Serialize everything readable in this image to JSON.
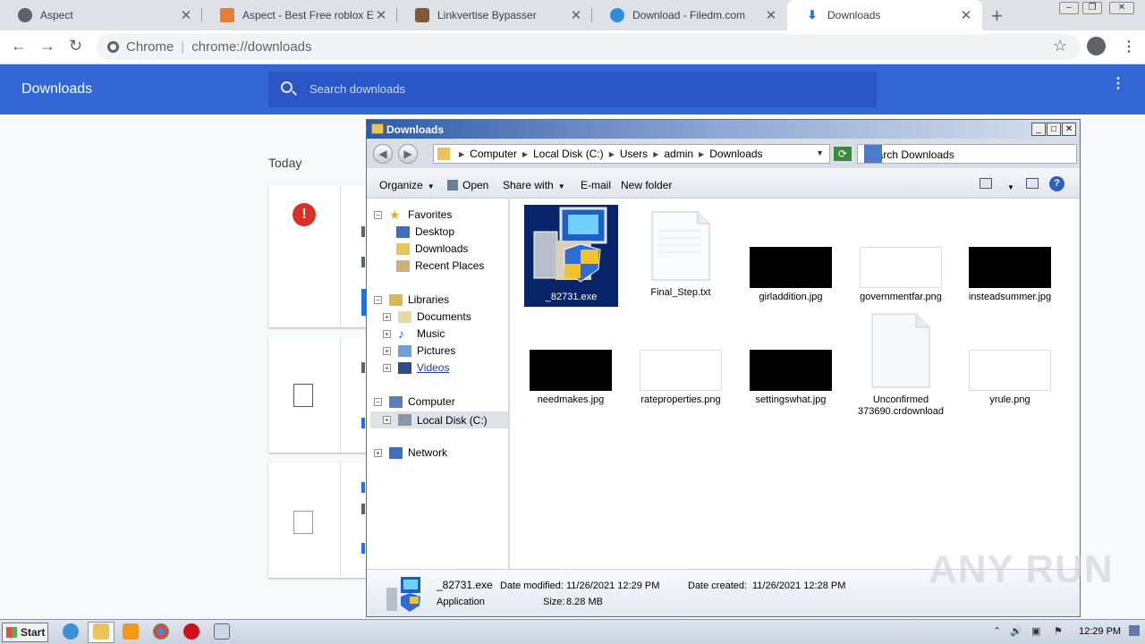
{
  "chrome": {
    "tabs": [
      {
        "title": "Aspect",
        "active": false
      },
      {
        "title": "Aspect - Best Free roblox Exploit",
        "active": false
      },
      {
        "title": "Linkvertise Bypasser",
        "active": false
      },
      {
        "title": "Download - Filedm.com",
        "active": false
      },
      {
        "title": "Downloads",
        "active": true
      }
    ],
    "new_tab_label": "+",
    "omnibox": {
      "scheme_label": "Chrome",
      "separator": "|",
      "url": "chrome://downloads"
    }
  },
  "downloads_page": {
    "title": "Downloads",
    "search_placeholder": "Search downloads",
    "section_date": "Today"
  },
  "explorer": {
    "title": "Downloads",
    "breadcrumb": [
      "Computer",
      "Local Disk (C:)",
      "Users",
      "admin",
      "Downloads"
    ],
    "search_placeholder": "Search Downloads",
    "commands": {
      "organize": "Organize",
      "open": "Open",
      "share_with": "Share with",
      "email": "E-mail",
      "new_folder": "New folder"
    },
    "nav": {
      "favorites": "Favorites",
      "desktop": "Desktop",
      "downloads": "Downloads",
      "recent_places": "Recent Places",
      "libraries": "Libraries",
      "documents": "Documents",
      "music": "Music",
      "pictures": "Pictures",
      "videos": "Videos",
      "computer": "Computer",
      "local_disk": "Local Disk (C:)",
      "network": "Network"
    },
    "files": [
      {
        "name": "_82731.exe",
        "kind": "exe",
        "selected": true
      },
      {
        "name": "Final_Step.txt",
        "kind": "txt"
      },
      {
        "name": "girladdition.jpg",
        "kind": "dark"
      },
      {
        "name": "governmentfar.png",
        "kind": "light"
      },
      {
        "name": "insteadsummer.jpg",
        "kind": "dark"
      },
      {
        "name": "needmakes.jpg",
        "kind": "dark"
      },
      {
        "name": "rateproperties.png",
        "kind": "light"
      },
      {
        "name": "settingswhat.jpg",
        "kind": "dark"
      },
      {
        "name_line1": "Unconfirmed",
        "name_line2": "373690.crdownload",
        "kind": "blank"
      },
      {
        "name": "yrule.png",
        "kind": "light"
      }
    ],
    "details": {
      "name": "_82731.exe",
      "type": "Application",
      "modified_label": "Date modified:",
      "modified_value": "11/26/2021 12:29 PM",
      "created_label": "Date created:",
      "created_value": "11/26/2021 12:28 PM",
      "size_label": "Size:",
      "size_value": "8.28 MB"
    }
  },
  "taskbar": {
    "start_label": "Start",
    "clock": "12:29 PM"
  },
  "watermark": "ANY RUN",
  "colors": {
    "chrome_header": "#3367d6",
    "selection": "#0a246a",
    "error": "#d93025"
  }
}
